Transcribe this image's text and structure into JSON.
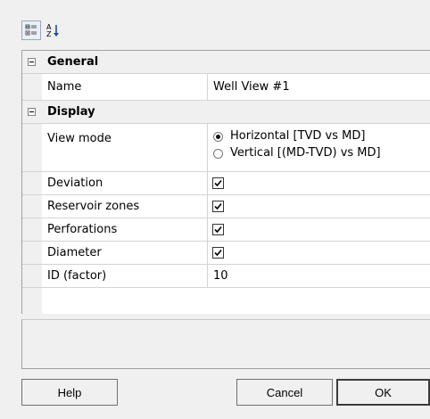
{
  "toolbar": {
    "categorized_icon": "categorized-view-icon",
    "alphabetical_icon": "alphabetical-sort-icon",
    "alphabetical_glyph_a": "A",
    "alphabetical_glyph_z": "Z"
  },
  "grid": {
    "categories": [
      {
        "label": "General",
        "expanded": true,
        "properties": [
          {
            "name": "Name",
            "value": "Well View #1"
          }
        ]
      },
      {
        "label": "Display",
        "expanded": true,
        "properties": [
          {
            "name": "View mode",
            "options": [
              "Horizontal [TVD vs MD]",
              "Vertical [(MD-TVD) vs MD]"
            ],
            "selected": "Horizontal [TVD vs MD]"
          },
          {
            "name": "Deviation",
            "checked": true
          },
          {
            "name": "Reservoir zones",
            "checked": true
          },
          {
            "name": "Perforations",
            "checked": true
          },
          {
            "name": "Diameter",
            "checked": true
          },
          {
            "name": "ID (factor)",
            "value": "10"
          }
        ]
      }
    ]
  },
  "buttons": {
    "help": "Help",
    "cancel": "Cancel",
    "ok": "OK"
  }
}
